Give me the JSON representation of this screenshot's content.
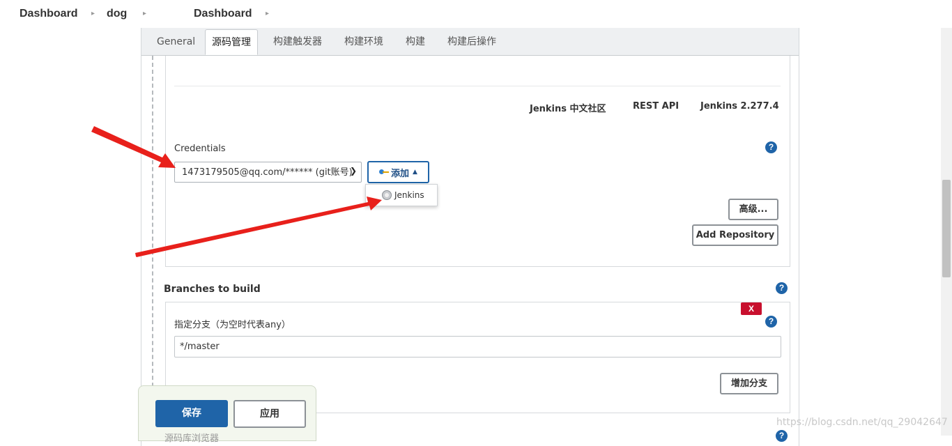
{
  "breadcrumb": {
    "items": [
      "Dashboard",
      "dog",
      "Dashboard"
    ]
  },
  "tabs": [
    "General",
    "源码管理",
    "构建触发器",
    "构建环境",
    "构建",
    "构建后操作"
  ],
  "active_tab": "源码管理",
  "footer_links": {
    "community": "Jenkins 中文社区",
    "rest_api": "REST API",
    "version": "Jenkins 2.277.4"
  },
  "credentials": {
    "label": "Credentials",
    "selected": "1473179505@qq.com/****** (git账号)",
    "add_label": "添加",
    "dropdown_items": [
      "Jenkins"
    ]
  },
  "buttons": {
    "advanced": "高级...",
    "add_repository": "Add Repository",
    "add_branch": "增加分支",
    "delete": "X",
    "save": "保存",
    "apply": "应用"
  },
  "branches": {
    "section_label": "Branches to build",
    "field_label": "指定分支（为空时代表any）",
    "value": "*/master"
  },
  "cutoff_text": "源码库浏览器",
  "watermark": "https://blog.csdn.net/qq_29042647",
  "help_symbol": "?",
  "icons": {
    "breadcrumb_sep": "chevron-right-icon",
    "select_arrow": "chevron-down-icon",
    "add_key": "key-icon",
    "caret": "caret-up-icon",
    "jenkins": "jenkins-icon",
    "help": "help-icon"
  },
  "colors": {
    "primary": "#1f64a8",
    "danger": "#c8102e",
    "annotation_arrow": "#e8201b"
  }
}
